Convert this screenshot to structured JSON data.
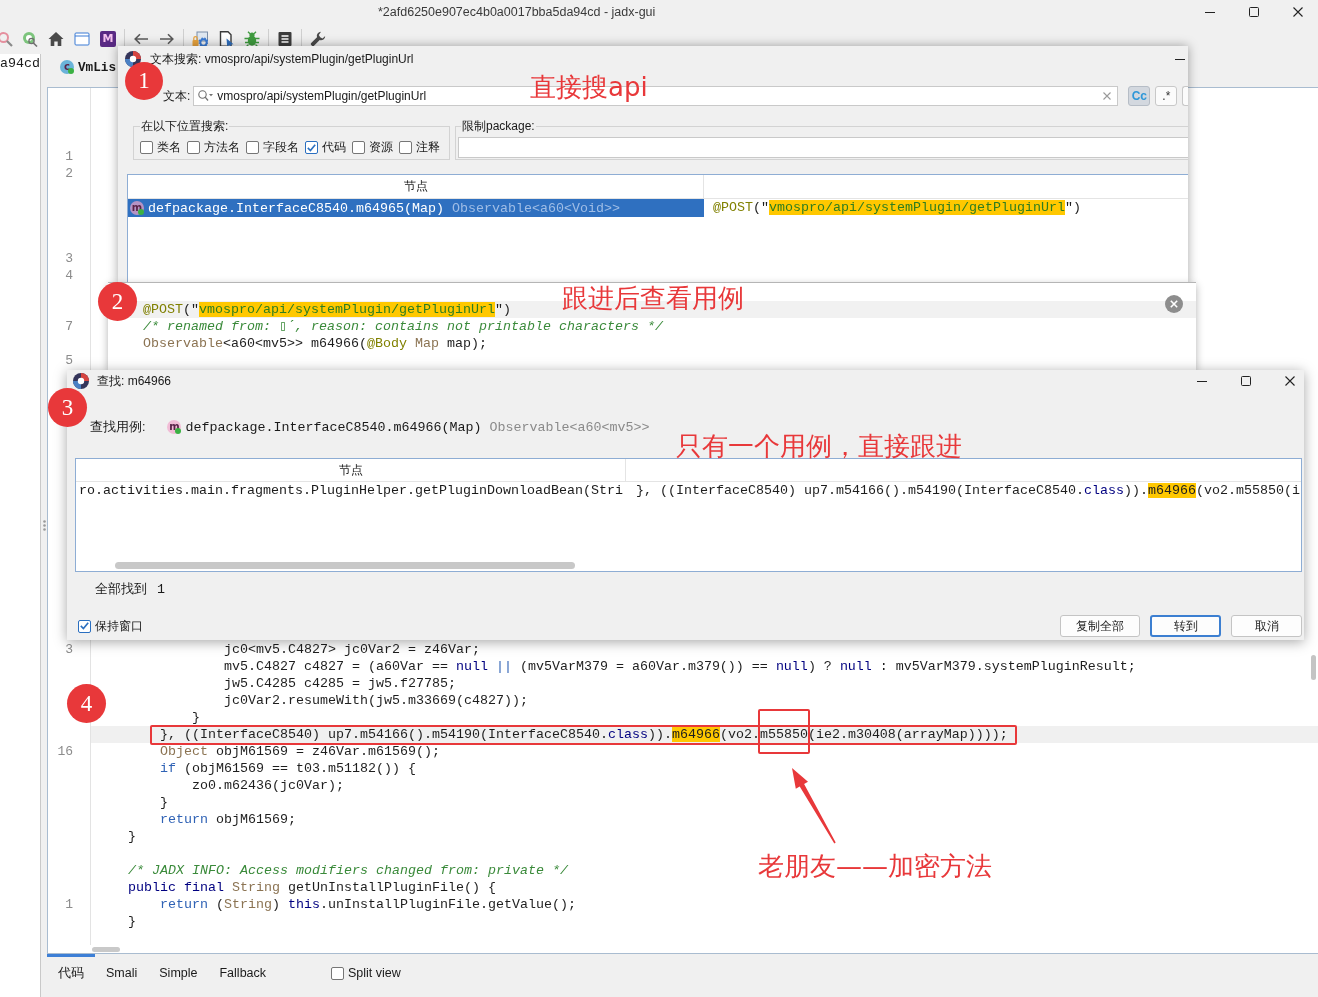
{
  "window": {
    "title": "*2afd6250e907ec4b0a0017bba5da94cd - jadx-gui"
  },
  "toolbar": {
    "letter_icon": "M"
  },
  "tree": {
    "items": [
      {
        "label": "a94cd"
      }
    ]
  },
  "editor": {
    "tabs": [
      {
        "icon_letter": "c",
        "label": "VmLis"
      }
    ],
    "badge": "4",
    "note": "老朋友——加密方法",
    "lines": [
      {
        "kind": "blank"
      },
      {
        "kind": "blank"
      },
      {
        "kind": "blank"
      },
      {
        "kind": "blank",
        "number": "1"
      },
      {
        "kind": "blank",
        "number": "2"
      },
      {
        "kind": "blank"
      },
      {
        "kind": "blank"
      },
      {
        "kind": "blank"
      },
      {
        "kind": "blank"
      },
      {
        "kind": "blank",
        "number": "3"
      },
      {
        "kind": "blank",
        "number": "4"
      },
      {
        "kind": "blank"
      },
      {
        "kind": "blank"
      },
      {
        "kind": "blank",
        "number": "7"
      },
      {
        "kind": "blank"
      },
      {
        "kind": "blank",
        "number": "5"
      },
      {
        "kind": "blank"
      },
      {
        "kind": "blank"
      },
      {
        "kind": "blank"
      },
      {
        "kind": "blank"
      },
      {
        "kind": "blank"
      },
      {
        "kind": "blank"
      },
      {
        "kind": "blank"
      },
      {
        "kind": "blank"
      },
      {
        "kind": "blank"
      },
      {
        "kind": "blank"
      },
      {
        "kind": "blank"
      },
      {
        "kind": "blank"
      },
      {
        "kind": "blank"
      },
      {
        "kind": "blank"
      },
      {
        "kind": "blank"
      },
      {
        "kind": "blank"
      },
      {
        "kind": "code",
        "number": "3",
        "current": false,
        "framed": false,
        "tokens": [
          {
            "text": "                jc0<mv5.C4827> jc0Var2 = z46Var;",
            "kind": "plain"
          }
        ]
      },
      {
        "kind": "code",
        "current": false,
        "framed": false,
        "tokens": [
          {
            "text": "                mv5.C4827 c4827 = (a60Var == ",
            "kind": "plain"
          },
          {
            "text": "null",
            "kind": "keyword"
          },
          {
            "text": " ||",
            "kind": "control"
          },
          {
            "text": " (mv5VarM379 = a60Var.m379()) == ",
            "kind": "plain"
          },
          {
            "text": "null",
            "kind": "keyword"
          },
          {
            "text": ") ? ",
            "kind": "plain"
          },
          {
            "text": "null",
            "kind": "keyword"
          },
          {
            "text": " : mv5VarM379.systemPluginResult;",
            "kind": "plain"
          }
        ]
      },
      {
        "kind": "code",
        "current": false,
        "framed": false,
        "tokens": [
          {
            "text": "                jw5.C4285 c4285 = jw5.f27785;",
            "kind": "plain"
          }
        ]
      },
      {
        "kind": "code",
        "current": false,
        "framed": false,
        "tokens": [
          {
            "text": "                jc0Var2.resumeWith(jw5.m33669(c4827));",
            "kind": "plain"
          }
        ]
      },
      {
        "kind": "code",
        "current": false,
        "framed": false,
        "tokens": [
          {
            "text": "            }",
            "kind": "plain"
          }
        ]
      },
      {
        "kind": "code",
        "current": true,
        "framed": true,
        "tokens": [
          {
            "text": "        }, ((InterfaceC8540) up7.m54166().m54190(InterfaceC8540.",
            "kind": "plain"
          },
          {
            "text": "class",
            "kind": "keyword"
          },
          {
            "text": ")).",
            "kind": "plain"
          },
          {
            "text": "m64966",
            "kind": "match"
          },
          {
            "text": "(vo2.",
            "kind": "plain"
          },
          {
            "text": "m55850",
            "kind": "framed"
          },
          {
            "text": "(ie2.m30408(arrayMap))));",
            "kind": "plain"
          }
        ]
      },
      {
        "kind": "code",
        "number": "16",
        "current": false,
        "framed": false,
        "tokens": [
          {
            "text": "        Object",
            "kind": "type"
          },
          {
            "text": " objM61569 = z46Var.m61569();",
            "kind": "plain"
          }
        ]
      },
      {
        "kind": "code",
        "current": false,
        "framed": false,
        "tokens": [
          {
            "text": "        if",
            "kind": "control"
          },
          {
            "text": " (objM61569 == t03.m51182()) {",
            "kind": "plain"
          }
        ]
      },
      {
        "kind": "code",
        "current": false,
        "framed": false,
        "tokens": [
          {
            "text": "            zo0.m62436(jc0Var);",
            "kind": "plain"
          }
        ]
      },
      {
        "kind": "code",
        "current": false,
        "framed": false,
        "tokens": [
          {
            "text": "        }",
            "kind": "plain"
          }
        ]
      },
      {
        "kind": "code",
        "current": false,
        "framed": false,
        "tokens": [
          {
            "text": "        return",
            "kind": "control"
          },
          {
            "text": " objM61569;",
            "kind": "plain"
          }
        ]
      },
      {
        "kind": "code",
        "current": false,
        "framed": false,
        "tokens": [
          {
            "text": "    }",
            "kind": "plain"
          }
        ]
      },
      {
        "kind": "blank"
      },
      {
        "kind": "code",
        "current": false,
        "framed": false,
        "tokens": [
          {
            "text": "    /* JADX INFO: Access modifiers changed from: private */",
            "kind": "comment"
          }
        ]
      },
      {
        "kind": "code",
        "current": false,
        "framed": false,
        "tokens": [
          {
            "text": "    public final ",
            "kind": "keyword"
          },
          {
            "text": "String",
            "kind": "type"
          },
          {
            "text": " getUnInstallPluginFile() {",
            "kind": "plain"
          }
        ]
      },
      {
        "kind": "code",
        "number": "1",
        "current": false,
        "framed": false,
        "tokens": [
          {
            "text": "        return",
            "kind": "control"
          },
          {
            "text": " (",
            "kind": "plain"
          },
          {
            "text": "String",
            "kind": "type"
          },
          {
            "text": ") ",
            "kind": "plain"
          },
          {
            "text": "this",
            "kind": "keyword"
          },
          {
            "text": ".unInstallPluginFile.getValue();",
            "kind": "plain"
          }
        ]
      },
      {
        "kind": "code",
        "current": false,
        "framed": false,
        "tokens": [
          {
            "text": "    }",
            "kind": "plain"
          }
        ]
      }
    ],
    "bottom_tabs": [
      {
        "label": "代码",
        "selected": true
      },
      {
        "label": "Smali",
        "selected": false
      },
      {
        "label": "Simple",
        "selected": false
      },
      {
        "label": "Fallback",
        "selected": false
      }
    ],
    "split_view": {
      "label": "Split view",
      "checked": false
    }
  },
  "search_dialog": {
    "title": "文本搜索: vmospro/api/systemPlugin/getPluginUrl",
    "badge": "1",
    "note": "直接搜api",
    "search_label": "文本:",
    "search_value": "vmospro/api/systemPlugin/getPluginUrl",
    "options": [
      {
        "label": "Cc",
        "selected": true
      },
      {
        "label": ".*",
        "selected": false
      },
      {
        "selected": false
      }
    ],
    "scope": {
      "title": "在以下位置搜索:",
      "checkboxes": [
        {
          "label": "类名",
          "checked": false
        },
        {
          "label": "方法名",
          "checked": false
        },
        {
          "label": "字段名",
          "checked": false
        },
        {
          "label": "代码",
          "checked": true
        },
        {
          "label": "资源",
          "checked": false
        },
        {
          "label": "注释",
          "checked": false
        }
      ]
    },
    "package_filter": {
      "title": "限制package:"
    },
    "table": {
      "columns": [
        "节点"
      ],
      "rows": [
        {
          "selected": true,
          "icon_letter": "m",
          "node": "defpackage.InterfaceC8540.m64965(Map)",
          "return_type": "Observable<a60<Void>>",
          "code": [
            {
              "text": "@POST",
              "kind": "annotation"
            },
            {
              "text": "(\"",
              "kind": "plain"
            },
            {
              "text": "vmospro/api/systemPlugin/getPluginUrl",
              "kind": "stringmatch"
            },
            {
              "text": "\")",
              "kind": "plain"
            }
          ]
        }
      ]
    }
  },
  "code_popup": {
    "badge": "2",
    "note": "跟进后查看用例",
    "lines": [
      {
        "current": true,
        "tokens": [
          {
            "text": "@POST",
            "kind": "annotation"
          },
          {
            "text": "(\"",
            "kind": "plain"
          },
          {
            "text": "vmospro/api/systemPlugin/getPluginUrl",
            "kind": "stringmatch"
          },
          {
            "text": "\")",
            "kind": "plain"
          }
        ]
      },
      {
        "current": false,
        "tokens": [
          {
            "text": "/* renamed from: ▯ˊ, reason: contains not printable characters */",
            "kind": "comment"
          }
        ]
      },
      {
        "current": false,
        "tokens": [
          {
            "text": "Observable",
            "kind": "type"
          },
          {
            "text": "<a60<mv5>> m64966(",
            "kind": "plain"
          },
          {
            "text": "@Body",
            "kind": "annotation"
          },
          {
            "text": " Map",
            "kind": "type"
          },
          {
            "text": " map);",
            "kind": "plain"
          }
        ]
      }
    ]
  },
  "find_dialog": {
    "title": "查找: m64966",
    "badge": "3",
    "note": "只有一个用例，直接跟进",
    "usage_label": "查找用例:",
    "target": {
      "icon_letter": "m",
      "name": "defpackage.InterfaceC8540.m64966(Map)",
      "return_type": "Observable<a60<mv5>>"
    },
    "table": {
      "columns": [
        "节点"
      ],
      "rows": [
        {
          "selected": false,
          "node": "ro.activities.main.fragments.PluginHelper.getPluginDownloadBean(Stri",
          "code": [
            {
              "text": "}, ((InterfaceC8540) up7.m54166().m54190(InterfaceC8540.",
              "kind": "plain"
            },
            {
              "text": "class",
              "kind": "keyword"
            },
            {
              "text": ")).",
              "kind": "plain"
            },
            {
              "text": "m64966",
              "kind": "match"
            },
            {
              "text": "(vo2.m55850(i",
              "kind": "plain"
            }
          ]
        }
      ]
    },
    "status": "全部找到",
    "count": "1",
    "keep_open": {
      "label": "保持窗口",
      "checked": true
    },
    "buttons": [
      {
        "label": "复制全部",
        "focused": false
      },
      {
        "label": "转到",
        "focused": true
      },
      {
        "label": "取消",
        "focused": false
      }
    ]
  }
}
